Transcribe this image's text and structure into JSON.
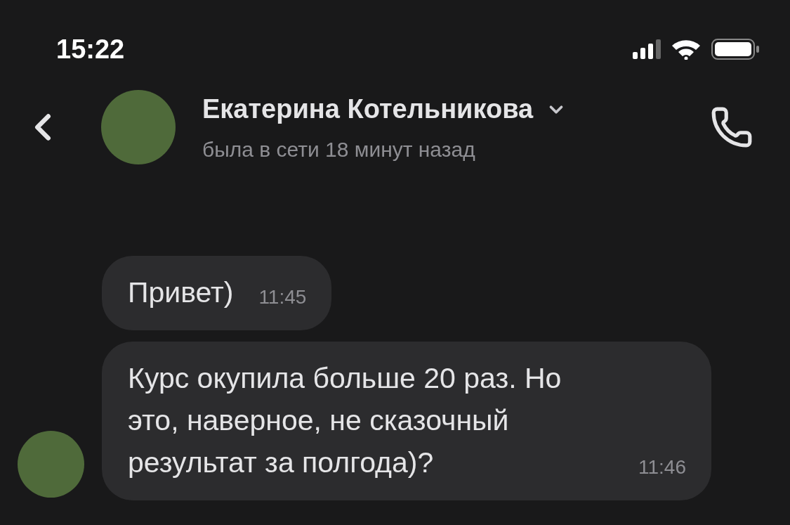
{
  "status_bar": {
    "time": "15:22"
  },
  "header": {
    "name": "Екатерина Котельникова",
    "status": "была в сети 18 минут назад"
  },
  "messages": [
    {
      "text": "Привет)",
      "time": "11:45",
      "show_avatar": false
    },
    {
      "text": "Курс окупила больше 20 раз. Но это, наверное, не сказочный результат за полгода)?",
      "time": "11:46",
      "show_avatar": true
    }
  ]
}
